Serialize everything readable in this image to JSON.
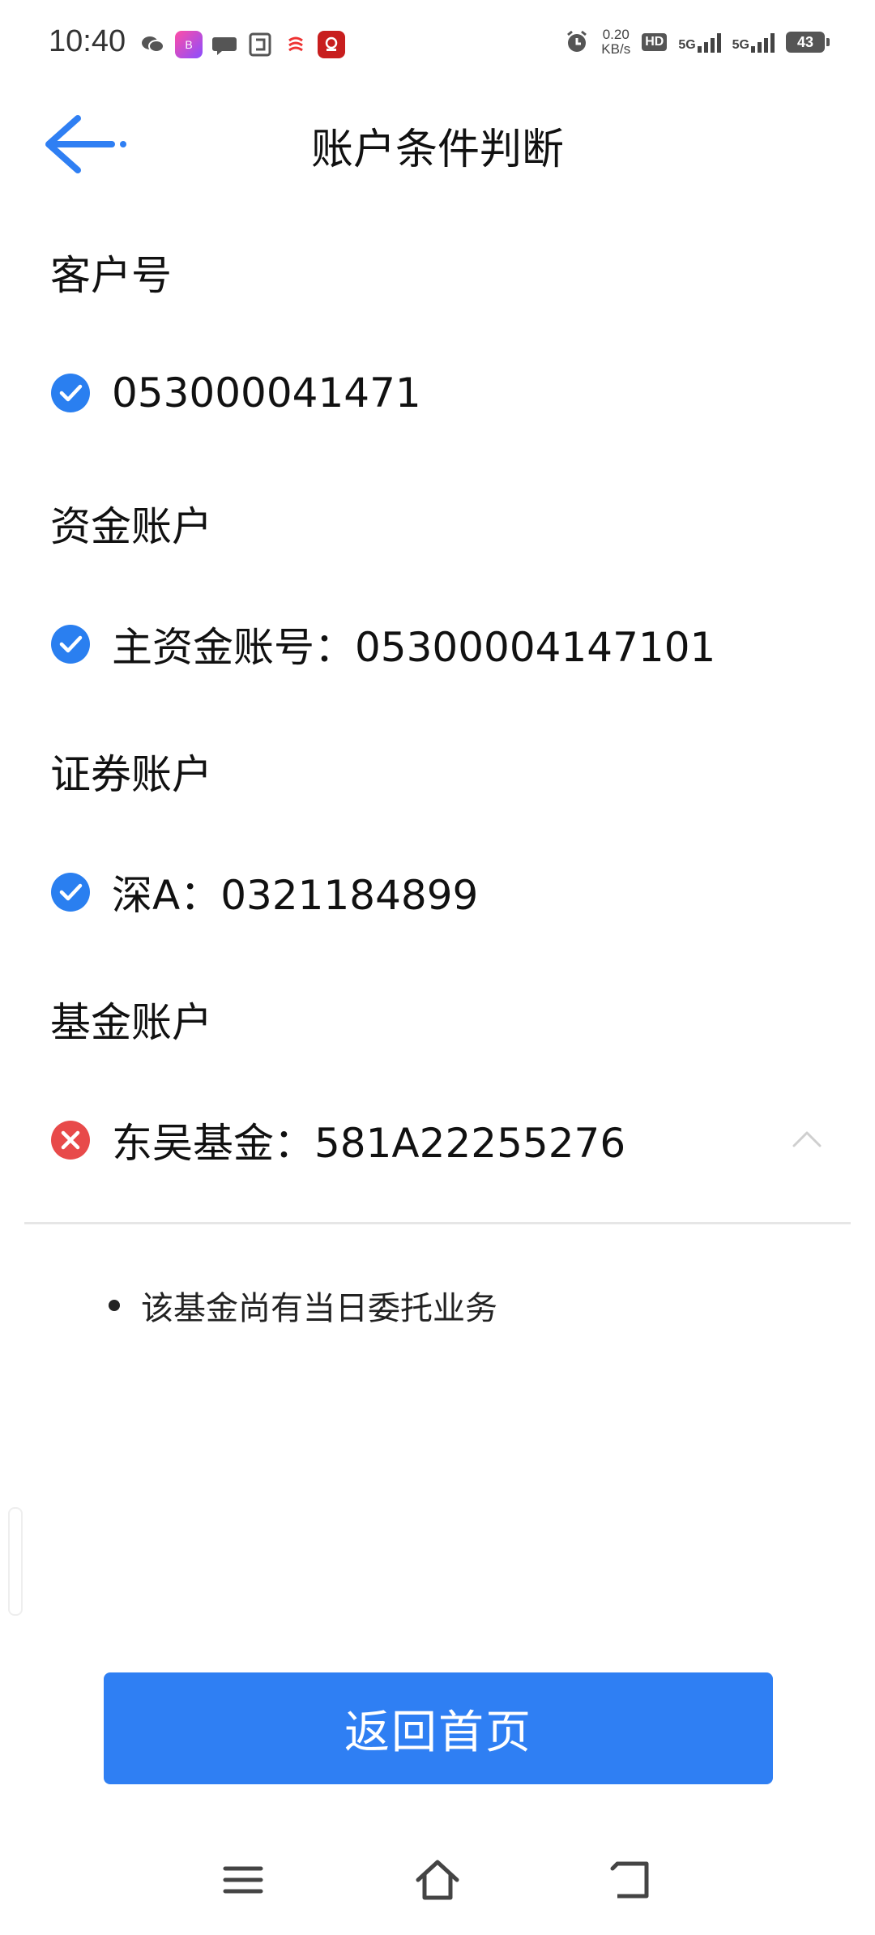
{
  "status_bar": {
    "time": "10:40",
    "net_speed_value": "0.20",
    "net_speed_unit": "KB/s",
    "hd_label": "HD",
    "sim1_label": "5G",
    "sim2_label": "5G",
    "battery": "43"
  },
  "header": {
    "title": "账户条件判断",
    "back_icon": "arrow-left-icon"
  },
  "sections": {
    "customer": {
      "title": "客户号",
      "item": "053000041471",
      "status": "ok"
    },
    "fund_account": {
      "title": "资金账户",
      "item": "主资金账号：05300004147101",
      "status": "ok"
    },
    "securities": {
      "title": "证券账户",
      "item": "深A：0321184899",
      "status": "ok"
    },
    "fund": {
      "title": "基金账户",
      "item": "东吴基金：581A22255276",
      "status": "error",
      "note": "该基金尚有当日委托业务"
    }
  },
  "actions": {
    "home_button": "返回首页"
  },
  "colors": {
    "accent": "#2f7ff3",
    "check": "#2a7ff0",
    "error": "#e84a4a"
  }
}
